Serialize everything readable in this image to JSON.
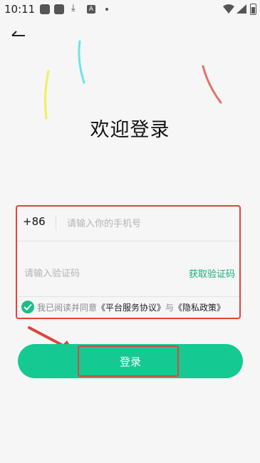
{
  "status_bar": {
    "time": "10:11",
    "download_glyph": "⤓",
    "notif_letter": "A"
  },
  "nav": {
    "back_icon": "back-arrow-icon"
  },
  "page": {
    "title": "欢迎登录"
  },
  "form": {
    "country_code": "+86",
    "phone_placeholder": "请输入你的手机号",
    "phone_value": "",
    "code_placeholder": "请输入验证码",
    "code_value": "",
    "get_code_label": "获取验证码",
    "agreement": {
      "checked": true,
      "prefix": "我已阅读并同意",
      "terms_link": "《平台服务协议》",
      "conjunction": "与",
      "privacy_link": "《隐私政策》"
    }
  },
  "login_button": {
    "label": "登录"
  },
  "colors": {
    "accent": "#15c992",
    "link_green": "#1aae78",
    "annotation_red": "#e0433b",
    "background": "#f5f6f5"
  }
}
